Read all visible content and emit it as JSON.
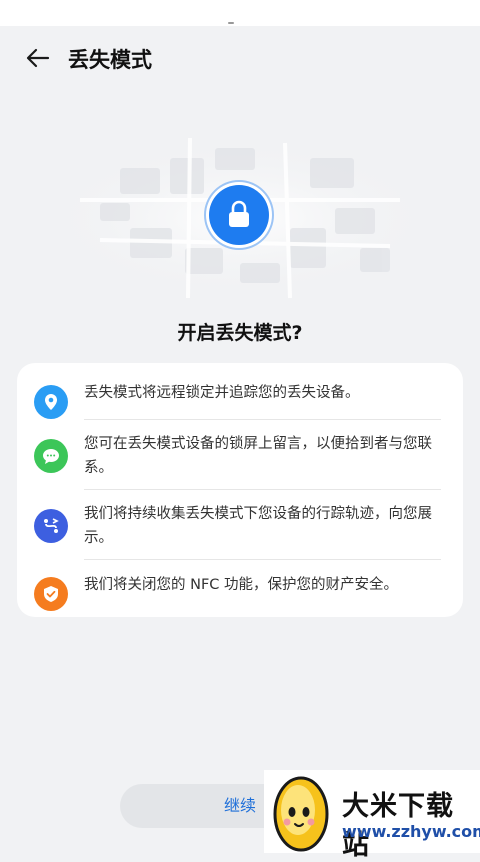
{
  "header": {
    "title": "丢失模式"
  },
  "hero": {
    "question": "开启丢失模式?"
  },
  "features": [
    {
      "icon": "location-pin-icon",
      "color": "#2a9df4",
      "text": "丢失模式将远程锁定并追踪您的丢失设备。"
    },
    {
      "icon": "message-icon",
      "color": "#3cc659",
      "text": "您可在丢失模式设备的锁屏上留言，以便拾到者与您联系。"
    },
    {
      "icon": "track-path-icon",
      "color": "#3d5fe0",
      "text": "我们将持续收集丢失模式下您设备的行踪轨迹，向您展示。"
    },
    {
      "icon": "shield-icon",
      "color": "#f57c1f",
      "text": "我们将关闭您的 NFC 功能，保护您的财产安全。"
    }
  ],
  "actions": {
    "continue_label": "继续"
  },
  "watermark": {
    "name": "大米下载站",
    "url": "www.zzhyw.com"
  },
  "colors": {
    "accent": "#1e7cf0",
    "background": "#f1f2f4"
  }
}
